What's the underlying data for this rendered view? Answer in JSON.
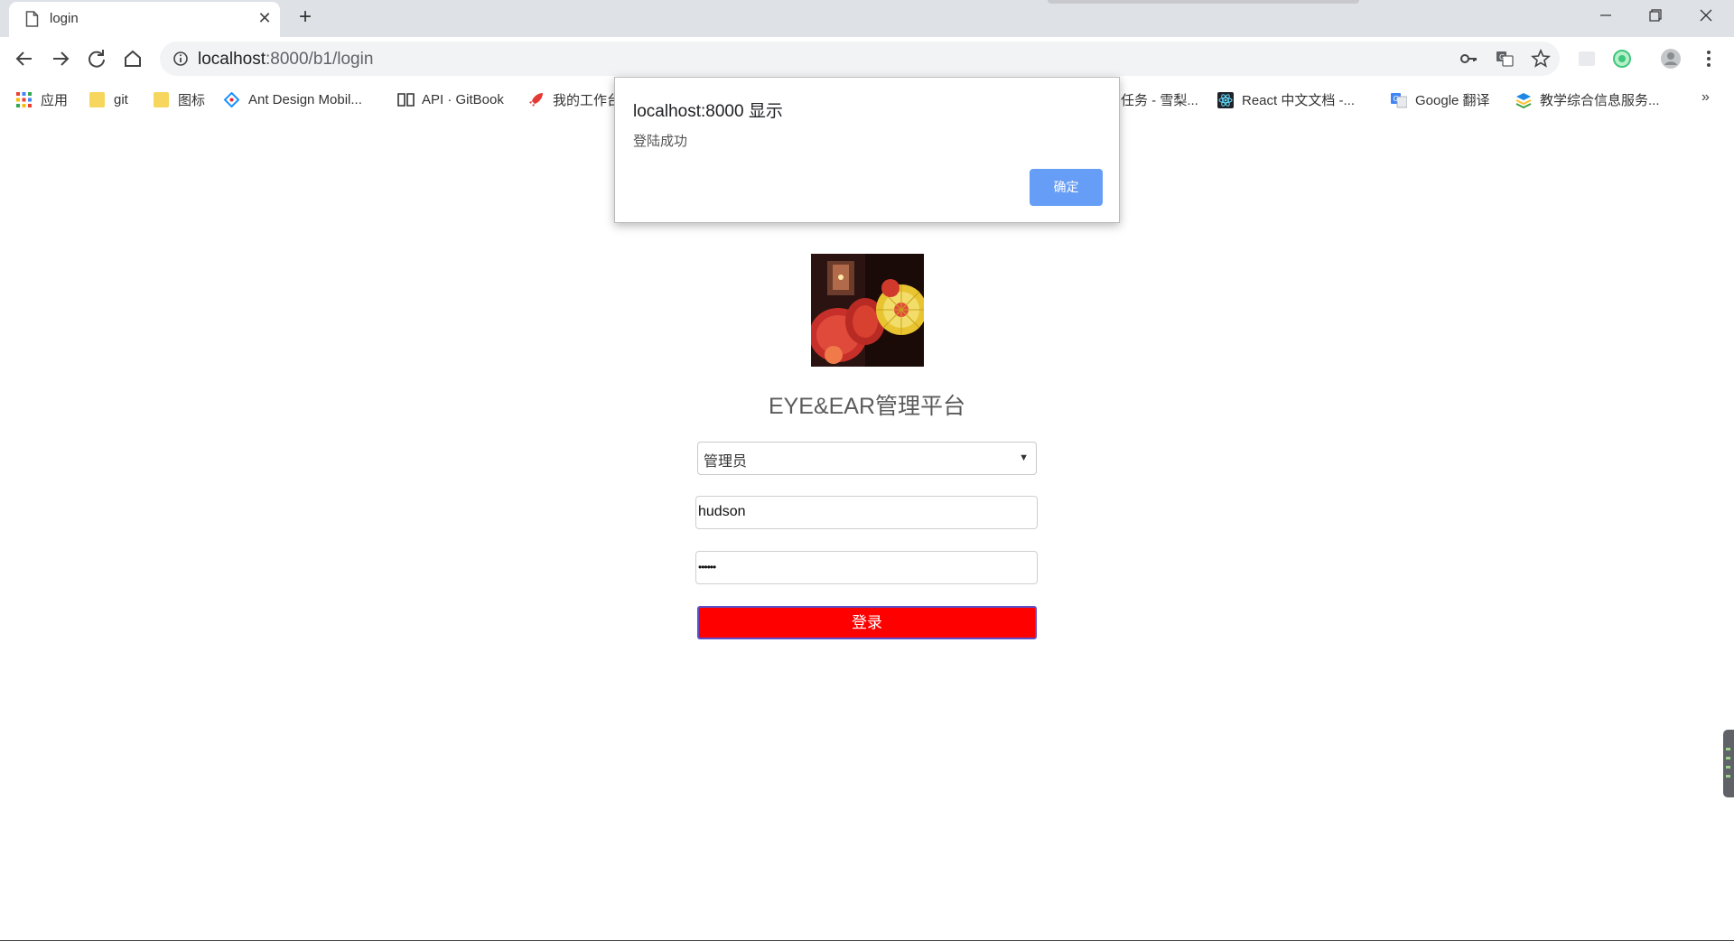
{
  "browser": {
    "tab": {
      "title": "login"
    },
    "url": {
      "host": "localhost",
      "rest": ":8000/b1/login"
    },
    "bookmarks": [
      {
        "label": "应用",
        "icon": "apps-grid-icon"
      },
      {
        "label": "git",
        "icon": "folder-icon"
      },
      {
        "label": "图标",
        "icon": "folder-icon"
      },
      {
        "label": "Ant Design Mobil...",
        "icon": "ant-design-icon"
      },
      {
        "label": "API · GitBook",
        "icon": "book-icon"
      },
      {
        "label": "我的工作台",
        "icon": "rocket-icon"
      },
      {
        "label": "任务 - 雪梨...",
        "icon": "task-icon"
      },
      {
        "label": "React 中文文档 -...",
        "icon": "react-icon"
      },
      {
        "label": "Google 翻译",
        "icon": "google-translate-icon"
      },
      {
        "label": "教学综合信息服务...",
        "icon": "stack-icon"
      }
    ],
    "bookmarks_more": "»"
  },
  "page": {
    "title": "EYE&EAR管理平台",
    "role_select": {
      "value": "管理员"
    },
    "username": {
      "value": "hudson"
    },
    "password": {
      "value": "••••••"
    },
    "login_button": "登录"
  },
  "dialog": {
    "title": "localhost:8000 显示",
    "message": "登陆成功",
    "ok_label": "确定"
  },
  "colors": {
    "login_button": "#ff0000",
    "dialog_ok": "#669df6",
    "tabstrip": "#dee1e6"
  }
}
